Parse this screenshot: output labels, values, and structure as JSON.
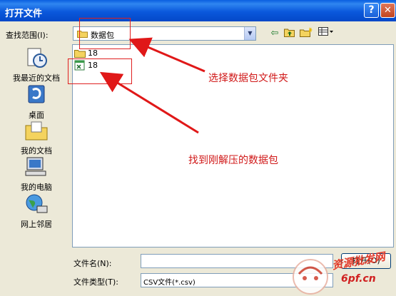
{
  "window": {
    "title": "打开文件",
    "help_glyph": "?",
    "close_glyph": "✕"
  },
  "lookin": {
    "label": "查找范围(I):",
    "value": "数据包"
  },
  "places": [
    {
      "label": "我最近的文档",
      "icon": "recent-documents-icon"
    },
    {
      "label": "桌面",
      "icon": "desktop-icon"
    },
    {
      "label": "我的文档",
      "icon": "my-documents-icon"
    },
    {
      "label": "我的电脑",
      "icon": "my-computer-icon"
    },
    {
      "label": "网上邻居",
      "icon": "network-places-icon"
    }
  ],
  "files": [
    {
      "name": "18",
      "type": "folder"
    },
    {
      "name": "18",
      "type": "csv-file"
    }
  ],
  "annotations": {
    "choose_folder": "选择数据包文件夹",
    "find_package": "找到刚解压的数据包"
  },
  "filename": {
    "label": "文件名(N):",
    "value": ""
  },
  "filetype": {
    "label": "文件类型(T):",
    "value": "CSV文件(*.csv)"
  },
  "buttons": {
    "open": "打开(O)"
  },
  "watermark": {
    "text": "资源批发网",
    "url": "6pf.cn"
  },
  "colors": {
    "titlebar": "#0a58dc",
    "annotation": "#d01818",
    "dialog_bg": "#ece9d8"
  }
}
